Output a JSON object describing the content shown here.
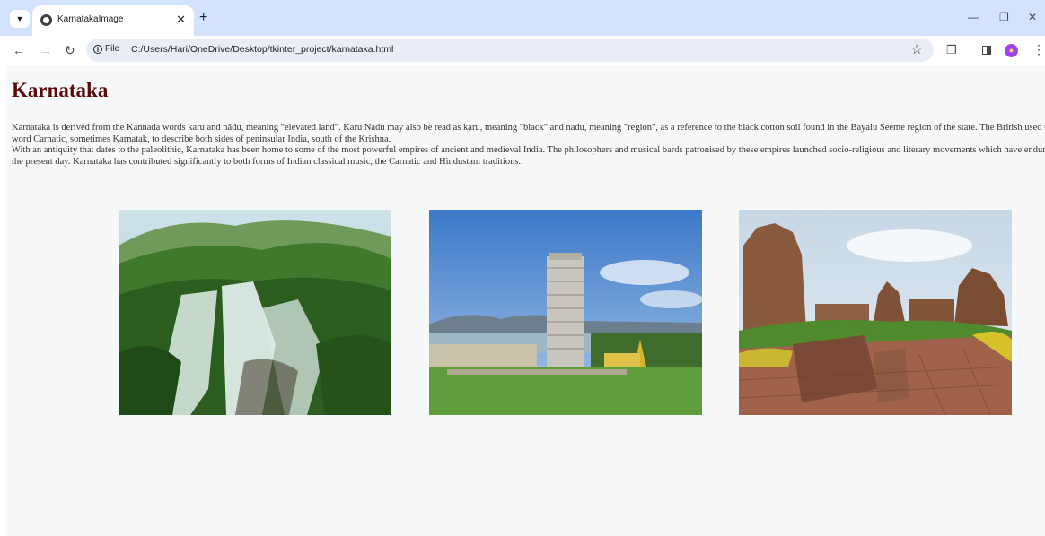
{
  "browser": {
    "tab_title": "KarnatakaImage",
    "site_info_label": "File",
    "url": "C:/Users/Hari/OneDrive/Desktop/tkinter_project/karnataka.html",
    "icons": [
      "tab-search-icon",
      "globe-icon",
      "close-icon",
      "plus-icon",
      "minimize-icon",
      "restore-icon",
      "back-icon",
      "forward-icon",
      "reload-icon",
      "info-icon",
      "star-icon",
      "extensions-icon",
      "side-panel-icon",
      "profile-avatar",
      "menu-icon"
    ]
  },
  "page": {
    "title": "Karnataka",
    "paragraph1": "Karnataka is derived from the Kannada words karu and nādu, meaning \"elevated land\". Karu Nadu may also be read as karu, meaning \"black\" and nadu, meaning \"region\", as a reference to the black cotton soil found in the Bayalu Seeme region of the state. The British used the word Carnatic, sometimes Karnatak, to describe both sides of peninsular India, south of the Krishna.",
    "paragraph2": "With an antiquity that dates to the paleolithic, Karnataka has been home to some of the most powerful empires of ancient and medieval India. The philosophers and musical bards patronised by these empires launched socio-religious and literary movements which have endured to the present day. Karnataka has contributed significantly to both forms of Indian classical music, the Carnatic and Hindustani traditions..",
    "colors": {
      "title": "#5a0a0a",
      "background": "#f7f8fa",
      "tabstrip": "#d3e3fd"
    }
  }
}
